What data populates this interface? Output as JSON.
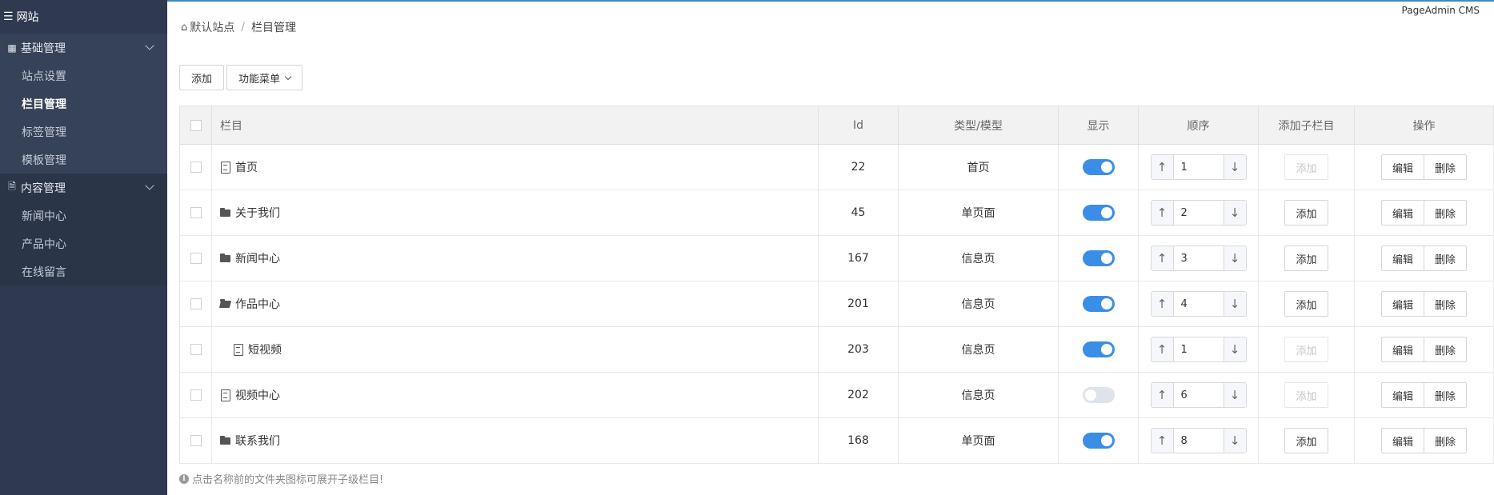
{
  "brand": "PageAdmin CMS",
  "sidebar": {
    "title": "网站",
    "groups": [
      {
        "label": "基础管理",
        "items": [
          "站点设置",
          "栏目管理",
          "标签管理",
          "模板管理"
        ]
      },
      {
        "label": "内容管理",
        "items": [
          "新闻中心",
          "产品中心",
          "在线留言"
        ]
      }
    ]
  },
  "breadcrumb": {
    "home": "默认站点",
    "separator": "/",
    "current": "栏目管理"
  },
  "toolbar": {
    "add": "添加",
    "menu": "功能菜单"
  },
  "table": {
    "headers": [
      "栏目",
      "Id",
      "类型/模型",
      "显示",
      "顺序",
      "添加子栏目",
      "操作"
    ],
    "rows": [
      {
        "name": "首页",
        "id": "22",
        "type": "首页",
        "order": "1",
        "icon": "page-icon",
        "shown": true,
        "add_enabled": false,
        "child": false
      },
      {
        "name": "关于我们",
        "id": "45",
        "type": "单页面",
        "order": "2",
        "icon": "folder-icon",
        "shown": true,
        "add_enabled": true,
        "child": false
      },
      {
        "name": "新闻中心",
        "id": "167",
        "type": "信息页",
        "order": "3",
        "icon": "folder-icon",
        "shown": true,
        "add_enabled": true,
        "child": false
      },
      {
        "name": "作品中心",
        "id": "201",
        "type": "信息页",
        "order": "4",
        "icon": "folder-open-icon",
        "shown": true,
        "add_enabled": true,
        "child": false
      },
      {
        "name": "短视频",
        "id": "203",
        "type": "信息页",
        "order": "1",
        "icon": "page-icon",
        "shown": true,
        "add_enabled": false,
        "child": true
      },
      {
        "name": "视频中心",
        "id": "202",
        "type": "信息页",
        "order": "6",
        "icon": "page-icon",
        "shown": false,
        "add_enabled": false,
        "child": false
      },
      {
        "name": "联系我们",
        "id": "168",
        "type": "单页面",
        "order": "8",
        "icon": "folder-icon",
        "shown": true,
        "add_enabled": true,
        "child": false
      }
    ],
    "add_label": "添加",
    "edit_label": "编辑",
    "delete_label": "删除",
    "up_arrow": "↑",
    "down_arrow": "↓"
  },
  "tip": "点击名称前的文件夹图标可展开子级栏目!",
  "colors": {
    "sidebar_bg": "#2f3a50",
    "toggle_on": "#3a8ee6",
    "toggle_off": "#dfe4ea"
  }
}
